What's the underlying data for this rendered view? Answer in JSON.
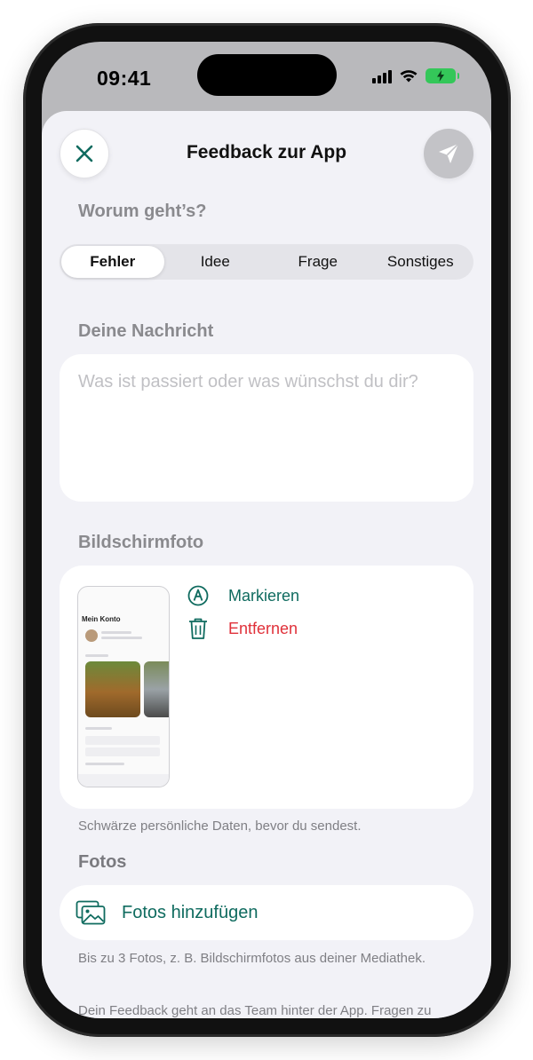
{
  "status_bar": {
    "time": "09:41"
  },
  "nav": {
    "title": "Feedback zur App"
  },
  "category": {
    "label": "Worum geht’s?",
    "options": [
      "Fehler",
      "Idee",
      "Frage",
      "Sonstiges"
    ],
    "selected": "Fehler"
  },
  "message": {
    "label": "Deine Nachricht",
    "placeholder": "Was ist passiert oder was wünschst du dir?",
    "value": ""
  },
  "screenshot": {
    "label": "Bildschirmfoto",
    "preview_title": "Mein Konto",
    "annotate_label": "Markieren",
    "remove_label": "Entfernen",
    "hint": "Schwärze persönliche Daten, bevor du sendest."
  },
  "photos": {
    "label": "Fotos",
    "add_label": "Fotos hinzufügen",
    "hint": "Bis zu 3 Fotos, z. B. Bildschirmfotos aus deiner Mediathek."
  },
  "footer": {
    "text": "Dein Feedback geht an das Team hinter der App. Fragen zu"
  },
  "colors": {
    "accent": "#0f6b5f",
    "destructive": "#e0313a",
    "battery": "#34c759"
  },
  "icons": {
    "close": "close-icon",
    "send": "paper-plane-icon",
    "annotate": "markup-pen-icon",
    "remove": "trash-icon",
    "photos": "photo-stack-icon"
  }
}
